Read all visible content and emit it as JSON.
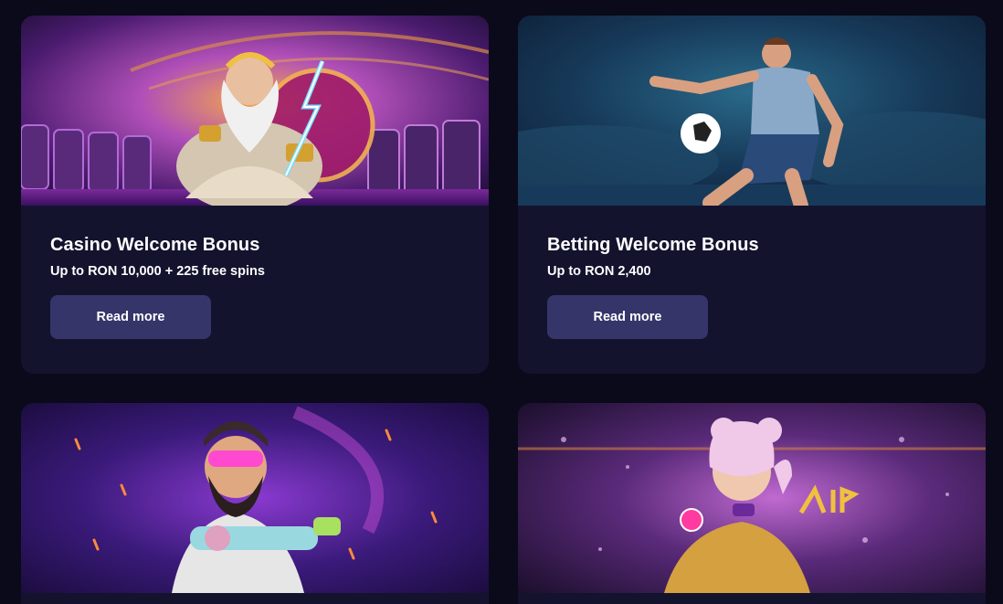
{
  "cards": [
    {
      "title": "Casino Welcome Bonus",
      "subtitle": "Up to RON 10,000 + 225 free spins",
      "button_label": "Read more",
      "art": "zeus-casino-illustration"
    },
    {
      "title": "Betting Welcome Bonus",
      "subtitle": "Up to RON 2,400",
      "button_label": "Read more",
      "art": "football-player-illustration"
    },
    {
      "title": "",
      "subtitle": "",
      "button_label": "",
      "art": "bearded-gunner-illustration"
    },
    {
      "title": "",
      "subtitle": "",
      "button_label": "",
      "art": "vip-clown-girl-illustration"
    }
  ],
  "colors": {
    "page_background": "#0a0a1a",
    "card_background": "#13132e",
    "button_background": "#35356a",
    "text": "#ffffff"
  }
}
